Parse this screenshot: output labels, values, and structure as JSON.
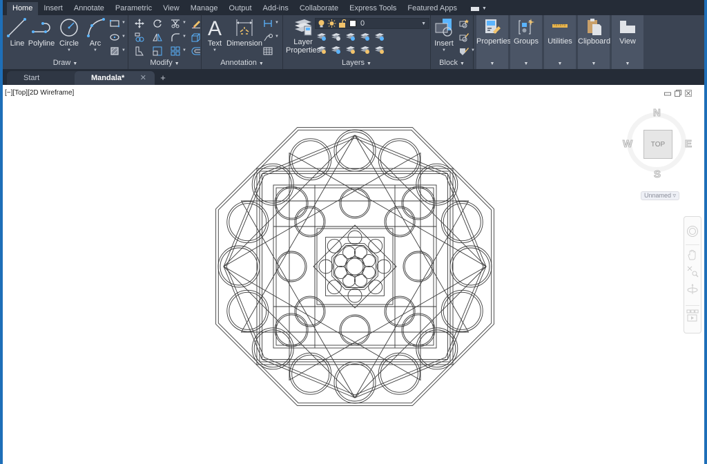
{
  "ribbon_tabs": [
    "Home",
    "Insert",
    "Annotate",
    "Parametric",
    "View",
    "Manage",
    "Output",
    "Add-ins",
    "Collaborate",
    "Express Tools",
    "Featured Apps"
  ],
  "active_ribbon_tab": "Home",
  "panels": {
    "draw": {
      "title": "Draw",
      "tools": [
        {
          "label": "Line",
          "icon": "line-icon"
        },
        {
          "label": "Polyline",
          "icon": "polyline-icon"
        },
        {
          "label": "Circle",
          "icon": "circle-icon"
        },
        {
          "label": "Arc",
          "icon": "arc-icon"
        }
      ],
      "small_tools": [
        "rectangle-icon",
        "ellipse-icon",
        "hatch-icon"
      ]
    },
    "modify": {
      "title": "Modify",
      "small_tools": [
        "move-icon",
        "rotate-icon",
        "trim-icon",
        "erase-icon",
        "copy-icon",
        "mirror-icon",
        "fillet-icon",
        "explode-icon",
        "stretch-icon",
        "scale-icon",
        "array-icon",
        "offset-icon"
      ]
    },
    "annotation": {
      "title": "Annotation",
      "tools": [
        {
          "label": "Text",
          "icon": "text-icon"
        },
        {
          "label": "Dimension",
          "icon": "dimension-icon"
        }
      ],
      "small_tools": [
        "linear-dimension-icon",
        "leader-icon",
        "table-icon"
      ]
    },
    "layers": {
      "title": "Layers",
      "big_tool": {
        "label_line1": "Layer",
        "label_line2": "Properties",
        "icon": "layer-properties-icon"
      },
      "current_layer": "0",
      "current_layer_color": "#ffffff",
      "small_tools": [
        "layer-off-icon",
        "layer-match-icon",
        "layer-freeze-icon",
        "layer-lock-icon",
        "layer-state-icon",
        "layer-on-icon",
        "layer-change-icon",
        "layer-thaw-icon",
        "layer-unlock-icon",
        "layer-isolate-icon"
      ]
    },
    "block": {
      "title": "Block",
      "tools": [
        {
          "label": "Insert",
          "icon": "insert-block-icon"
        }
      ],
      "small_tools": [
        "create-block-icon",
        "edit-block-icon",
        "edit-attributes-icon"
      ]
    },
    "collapsed": [
      {
        "label": "Properties",
        "icon": "properties-icon"
      },
      {
        "label": "Groups",
        "icon": "groups-icon"
      },
      {
        "label": "Utilities",
        "icon": "utilities-icon"
      },
      {
        "label": "Clipboard",
        "icon": "clipboard-icon"
      },
      {
        "label": "View",
        "icon": "view-icon"
      }
    ]
  },
  "doc_tabs": [
    {
      "label": "Start",
      "active": false
    },
    {
      "label": "Mandala*",
      "active": true,
      "close_glyph": "✕"
    }
  ],
  "new_tab_glyph": "+",
  "viewport": {
    "label": "[−][Top][2D Wireframe]",
    "viewcube": {
      "face": "TOP",
      "north": "N",
      "south": "S",
      "east": "E",
      "west": "W",
      "ucs": "Unnamed ▿"
    }
  },
  "colors": {
    "ribbon_bg": "#3b4453",
    "tabbar_bg": "#252c37",
    "accent_blue": "#1e6fb8",
    "canvas_bg": "#ffffff",
    "drawing_stroke": "#3a3a3a"
  }
}
